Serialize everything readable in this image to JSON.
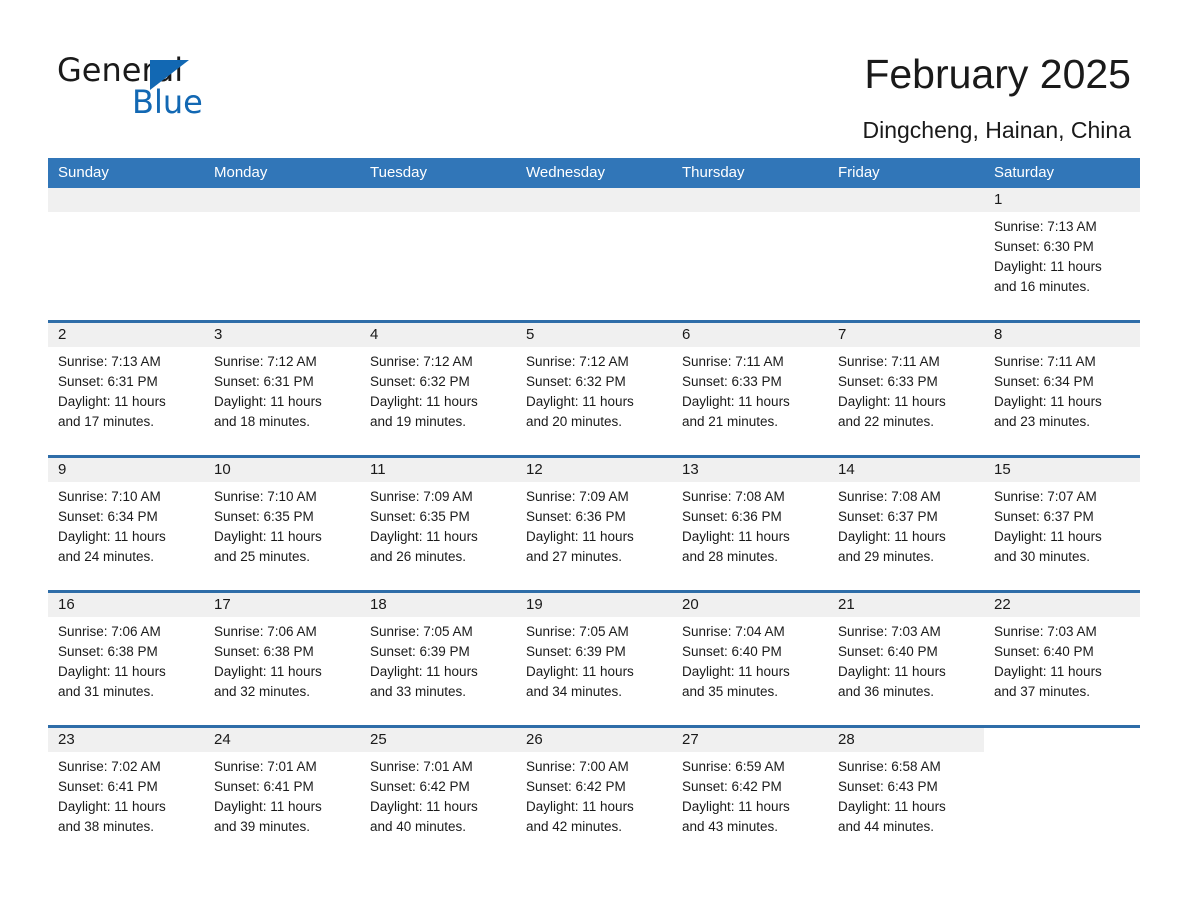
{
  "brand": {
    "name_part1": "General",
    "name_part2": "Blue",
    "logo_icon": "triangle-flag-icon",
    "accent_color": "#1268b3"
  },
  "header": {
    "title": "February 2025",
    "subtitle": "Dingcheng, Hainan, China"
  },
  "theme": {
    "header_row_bg": "#3176b8",
    "row_separator": "#2e6da8",
    "day_band_bg": "#f0f0f0",
    "text": "#1a1a1a"
  },
  "weekdays": [
    "Sunday",
    "Monday",
    "Tuesday",
    "Wednesday",
    "Thursday",
    "Friday",
    "Saturday"
  ],
  "weeks": [
    [
      {
        "day": "",
        "lines": []
      },
      {
        "day": "",
        "lines": []
      },
      {
        "day": "",
        "lines": []
      },
      {
        "day": "",
        "lines": []
      },
      {
        "day": "",
        "lines": []
      },
      {
        "day": "",
        "lines": []
      },
      {
        "day": "1",
        "lines": [
          "Sunrise: 7:13 AM",
          "Sunset: 6:30 PM",
          "Daylight: 11 hours",
          "and 16 minutes."
        ]
      }
    ],
    [
      {
        "day": "2",
        "lines": [
          "Sunrise: 7:13 AM",
          "Sunset: 6:31 PM",
          "Daylight: 11 hours",
          "and 17 minutes."
        ]
      },
      {
        "day": "3",
        "lines": [
          "Sunrise: 7:12 AM",
          "Sunset: 6:31 PM",
          "Daylight: 11 hours",
          "and 18 minutes."
        ]
      },
      {
        "day": "4",
        "lines": [
          "Sunrise: 7:12 AM",
          "Sunset: 6:32 PM",
          "Daylight: 11 hours",
          "and 19 minutes."
        ]
      },
      {
        "day": "5",
        "lines": [
          "Sunrise: 7:12 AM",
          "Sunset: 6:32 PM",
          "Daylight: 11 hours",
          "and 20 minutes."
        ]
      },
      {
        "day": "6",
        "lines": [
          "Sunrise: 7:11 AM",
          "Sunset: 6:33 PM",
          "Daylight: 11 hours",
          "and 21 minutes."
        ]
      },
      {
        "day": "7",
        "lines": [
          "Sunrise: 7:11 AM",
          "Sunset: 6:33 PM",
          "Daylight: 11 hours",
          "and 22 minutes."
        ]
      },
      {
        "day": "8",
        "lines": [
          "Sunrise: 7:11 AM",
          "Sunset: 6:34 PM",
          "Daylight: 11 hours",
          "and 23 minutes."
        ]
      }
    ],
    [
      {
        "day": "9",
        "lines": [
          "Sunrise: 7:10 AM",
          "Sunset: 6:34 PM",
          "Daylight: 11 hours",
          "and 24 minutes."
        ]
      },
      {
        "day": "10",
        "lines": [
          "Sunrise: 7:10 AM",
          "Sunset: 6:35 PM",
          "Daylight: 11 hours",
          "and 25 minutes."
        ]
      },
      {
        "day": "11",
        "lines": [
          "Sunrise: 7:09 AM",
          "Sunset: 6:35 PM",
          "Daylight: 11 hours",
          "and 26 minutes."
        ]
      },
      {
        "day": "12",
        "lines": [
          "Sunrise: 7:09 AM",
          "Sunset: 6:36 PM",
          "Daylight: 11 hours",
          "and 27 minutes."
        ]
      },
      {
        "day": "13",
        "lines": [
          "Sunrise: 7:08 AM",
          "Sunset: 6:36 PM",
          "Daylight: 11 hours",
          "and 28 minutes."
        ]
      },
      {
        "day": "14",
        "lines": [
          "Sunrise: 7:08 AM",
          "Sunset: 6:37 PM",
          "Daylight: 11 hours",
          "and 29 minutes."
        ]
      },
      {
        "day": "15",
        "lines": [
          "Sunrise: 7:07 AM",
          "Sunset: 6:37 PM",
          "Daylight: 11 hours",
          "and 30 minutes."
        ]
      }
    ],
    [
      {
        "day": "16",
        "lines": [
          "Sunrise: 7:06 AM",
          "Sunset: 6:38 PM",
          "Daylight: 11 hours",
          "and 31 minutes."
        ]
      },
      {
        "day": "17",
        "lines": [
          "Sunrise: 7:06 AM",
          "Sunset: 6:38 PM",
          "Daylight: 11 hours",
          "and 32 minutes."
        ]
      },
      {
        "day": "18",
        "lines": [
          "Sunrise: 7:05 AM",
          "Sunset: 6:39 PM",
          "Daylight: 11 hours",
          "and 33 minutes."
        ]
      },
      {
        "day": "19",
        "lines": [
          "Sunrise: 7:05 AM",
          "Sunset: 6:39 PM",
          "Daylight: 11 hours",
          "and 34 minutes."
        ]
      },
      {
        "day": "20",
        "lines": [
          "Sunrise: 7:04 AM",
          "Sunset: 6:40 PM",
          "Daylight: 11 hours",
          "and 35 minutes."
        ]
      },
      {
        "day": "21",
        "lines": [
          "Sunrise: 7:03 AM",
          "Sunset: 6:40 PM",
          "Daylight: 11 hours",
          "and 36 minutes."
        ]
      },
      {
        "day": "22",
        "lines": [
          "Sunrise: 7:03 AM",
          "Sunset: 6:40 PM",
          "Daylight: 11 hours",
          "and 37 minutes."
        ]
      }
    ],
    [
      {
        "day": "23",
        "lines": [
          "Sunrise: 7:02 AM",
          "Sunset: 6:41 PM",
          "Daylight: 11 hours",
          "and 38 minutes."
        ]
      },
      {
        "day": "24",
        "lines": [
          "Sunrise: 7:01 AM",
          "Sunset: 6:41 PM",
          "Daylight: 11 hours",
          "and 39 minutes."
        ]
      },
      {
        "day": "25",
        "lines": [
          "Sunrise: 7:01 AM",
          "Sunset: 6:42 PM",
          "Daylight: 11 hours",
          "and 40 minutes."
        ]
      },
      {
        "day": "26",
        "lines": [
          "Sunrise: 7:00 AM",
          "Sunset: 6:42 PM",
          "Daylight: 11 hours",
          "and 42 minutes."
        ]
      },
      {
        "day": "27",
        "lines": [
          "Sunrise: 6:59 AM",
          "Sunset: 6:42 PM",
          "Daylight: 11 hours",
          "and 43 minutes."
        ]
      },
      {
        "day": "28",
        "lines": [
          "Sunrise: 6:58 AM",
          "Sunset: 6:43 PM",
          "Daylight: 11 hours",
          "and 44 minutes."
        ]
      },
      {
        "day": null,
        "lines": []
      }
    ]
  ]
}
